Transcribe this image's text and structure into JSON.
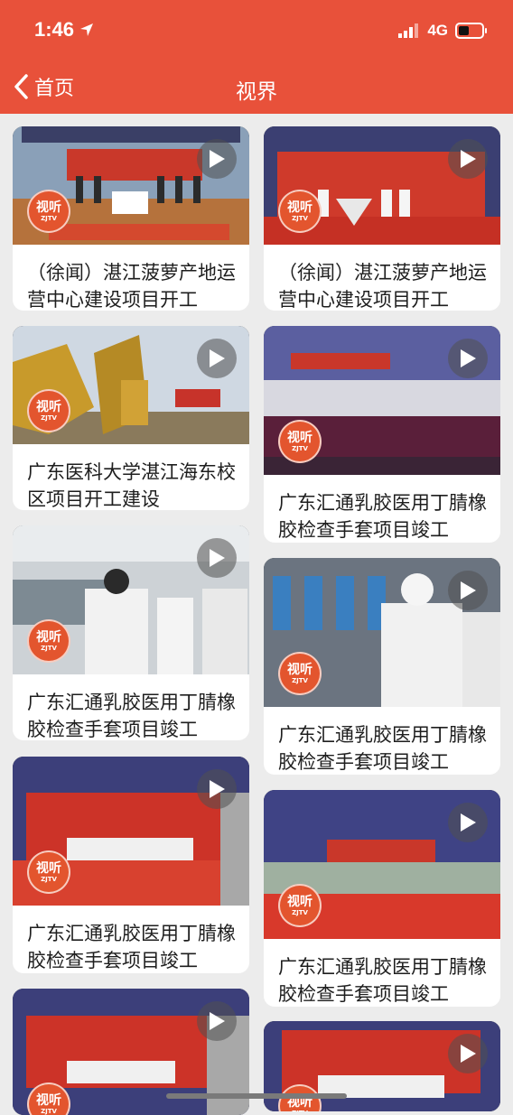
{
  "status_bar": {
    "time": "1:46",
    "network": "4G"
  },
  "nav": {
    "back_label": "首页",
    "title": "视界"
  },
  "logo": {
    "line1": "视听",
    "line2": "ZJTV"
  },
  "left_column": [
    {
      "title": "（徐闻）湛江菠萝产地运营中心建设项目开工",
      "scene": "groundbreaking-outdoor"
    },
    {
      "title": "广东医科大学湛江海东校区项目开工建设",
      "scene": "excavators"
    },
    {
      "title": "广东汇通乳胶医用丁腈橡胶检查手套项目竣工",
      "scene": "factory-visit"
    },
    {
      "title": "广东汇通乳胶医用丁腈橡胶检查手套项目竣工",
      "scene": "stage-ceremony"
    },
    {
      "title": "",
      "scene": "stage-ceremony-2"
    }
  ],
  "right_column": [
    {
      "title": "（徐闻）湛江菠萝产地运营中心建设项目开工",
      "scene": "stage-launch"
    },
    {
      "title": "广东汇通乳胶医用丁腈橡胶检查手套项目竣工",
      "scene": "meeting-tent"
    },
    {
      "title": "广东汇通乳胶医用丁腈橡胶检查手套项目竣工",
      "scene": "glove-line"
    },
    {
      "title": "广东汇通乳胶医用丁腈橡胶检查手套项目竣工",
      "scene": "stage-wide"
    },
    {
      "title": "",
      "scene": "stage-banner"
    }
  ],
  "colors": {
    "brand": "#e8513a",
    "background": "#ececec"
  }
}
